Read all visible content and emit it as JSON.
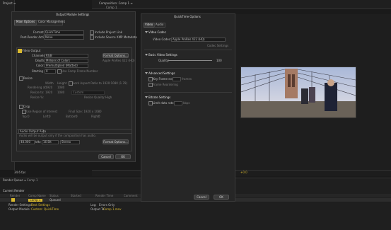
{
  "host": {
    "project_label": "Project ≡",
    "composition_tab": "Composition: Comp 1 ≡",
    "comp_tab": "Comp 1",
    "render_queue_tab": "Render Queue ≡",
    "comp1_tab": "Comp 1",
    "current_render_label": "Current Render",
    "zoom_value": "34.6 fps",
    "viewer_bottom_value": "+0.0"
  },
  "output_module": {
    "title": "Output Module Settings",
    "tabs": [
      "Main Options",
      "Color Management"
    ],
    "format_label": "Format:",
    "format_value": "QuickTime",
    "post_render_label": "Post-Render Action:",
    "post_render_value": "None",
    "include_project_link": "Include Project Link",
    "include_xmp": "Include Source XMP Metadata",
    "video_output_label": "Video Output",
    "channels_label": "Channels:",
    "channels_value": "RGB",
    "depth_label": "Depth:",
    "depth_value": "Millions of Colors",
    "color_label": "Color:",
    "color_value": "Premultiplied (Matted)",
    "starting_label": "Starting #:",
    "starting_value": "0",
    "use_comp_frame": "Use Comp Frame Number",
    "format_options_btn": "Format Options...",
    "codec_desc": "Apple ProRes 422 (HQ)",
    "resize_label": "Resize",
    "width_label": "Width",
    "height_label": "Height",
    "lock_aspect": "Lock Aspect Ratio to 1920:1080 (1.78)",
    "rendering_at_label": "Rendering at:",
    "rendering_w": "1920",
    "rendering_h": "1080",
    "resize_to_label": "Resize to:",
    "resize_w": "1920",
    "resize_h": "1080",
    "custom_value": "Custom",
    "resize_pct_label": "Resize %:",
    "resize_quality_label": "Resize Quality:",
    "resize_quality_value": "High",
    "crop_label": "Crop",
    "use_roi": "Use Region of Interest",
    "final_size": "Final Size: 1920 x 1080",
    "top_label": "Top:",
    "left_label": "Left:",
    "bottom_label": "Bottom:",
    "right_label": "Right:",
    "zero": "0",
    "audio_output_label": "Audio Output Auto",
    "audio_note": "Audio will be output only if the composition has audio.",
    "audio_rate": "48.000",
    "audio_rate_unit": "kHz",
    "audio_bits": "16 Bit",
    "audio_channels": "Stereo",
    "format_options_btn2": "Format Options...",
    "cancel_btn": "Cancel",
    "ok_btn": "OK"
  },
  "quicktime": {
    "title": "QuickTime Options",
    "tabs": [
      "Video",
      "Audio"
    ],
    "video_codec_section": "Video Codec",
    "video_codec_label": "Video Codec:",
    "video_codec_value": "Apple ProRes 422 (HQ)",
    "codec_settings_btn": "Codec Settings",
    "basic_settings_section": "Basic Video Settings",
    "quality_label": "Quality:",
    "quality_value": "100",
    "advanced_section": "Advanced Settings",
    "key_frame_label": "Key Frame every",
    "key_frame_unit": "frames",
    "frame_reordering": "Frame Reordering",
    "bitrate_section": "Bitrate Settings",
    "limit_data_label": "Limit data rate to",
    "limit_data_unit": "kbps",
    "cancel_btn": "Cancel",
    "ok_btn": "OK"
  },
  "render_queue": {
    "render_settings_label": "Render Settings:",
    "render_settings_value": "Best Settings",
    "output_module_label": "Output Module:",
    "output_module_value": "Custom: QuickTime",
    "log_label": "Log:",
    "log_value": "Errors Only",
    "output_to_label": "Output To:",
    "output_to_value": "Comp 1.mov",
    "item_name": "Comp 1",
    "status": "Queued",
    "col_render": "Render",
    "col_name": "Comp Name",
    "col_status": "Status",
    "col_started": "Started",
    "col_time": "Render Time",
    "col_comment": "Comment"
  },
  "colors": {
    "accent_yellow": "#d9b92f",
    "panel": "#262626",
    "background": "#1a1a1a"
  }
}
